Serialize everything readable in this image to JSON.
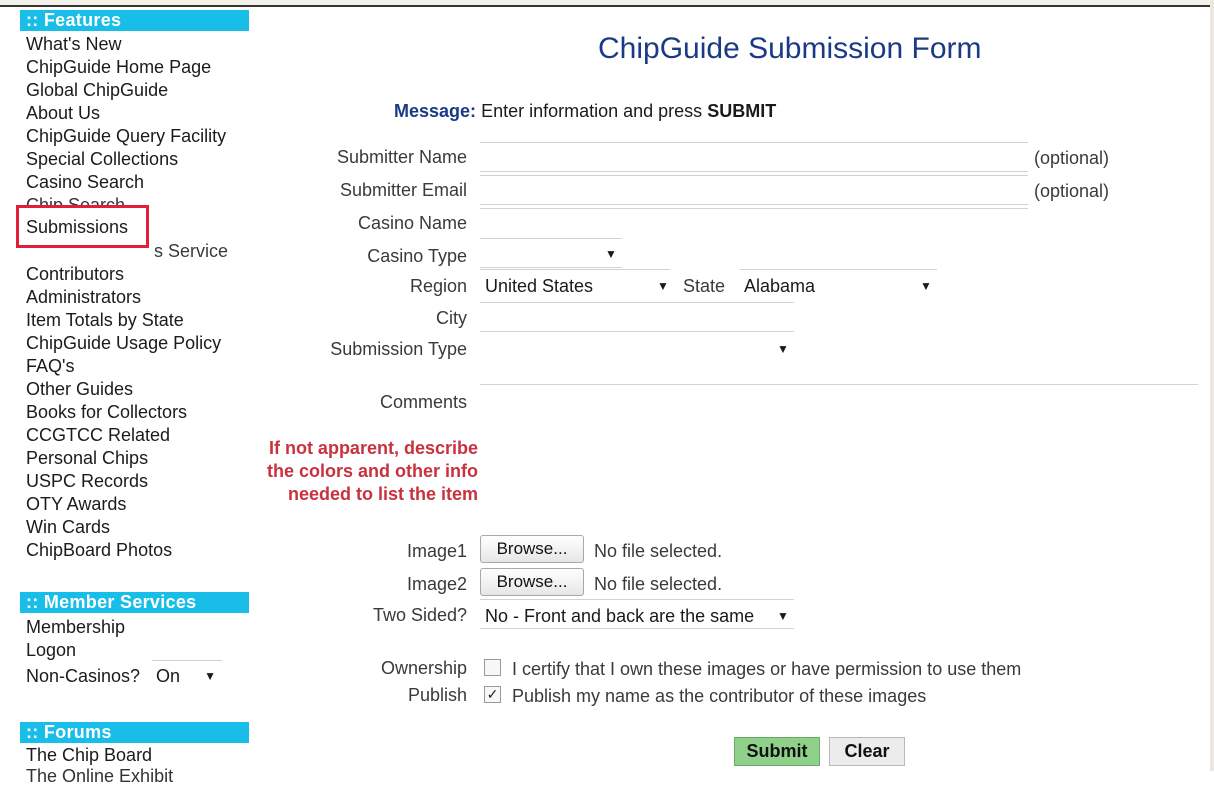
{
  "sidebar": {
    "features_header": ":: Features",
    "features_links": [
      "What's New",
      "ChipGuide Home Page",
      "Global ChipGuide",
      "About Us",
      "ChipGuide Query Facility",
      "Special Collections",
      "Casino Search",
      "Chip Search",
      "Submissions",
      "s Service",
      "Contributors",
      "Administrators",
      "Item Totals by State",
      "ChipGuide Usage Policy",
      "FAQ's",
      "Other Guides",
      "Books for Collectors",
      "CCGTCC Related",
      "Personal Chips",
      "USPC Records",
      "OTY Awards",
      "Win Cards",
      "ChipBoard Photos"
    ],
    "member_header": ":: Member Services",
    "member_links": [
      "Membership",
      "Logon"
    ],
    "non_casinos_label": "Non-Casinos?",
    "non_casinos_value": "On",
    "forums_header": ":: Forums",
    "forums_links": [
      "The Chip Board",
      "The Online Exhibit"
    ]
  },
  "form": {
    "title": "ChipGuide Submission Form",
    "message_key": "Message:",
    "message_text": "Enter information and press",
    "message_bold": "SUBMIT",
    "labels": {
      "submitter_name": "Submitter Name",
      "submitter_email": "Submitter Email",
      "casino_name": "Casino Name",
      "casino_type": "Casino Type",
      "region": "Region",
      "state": "State",
      "city": "City",
      "submission_type": "Submission Type",
      "comments": "Comments",
      "image1": "Image1",
      "image2": "Image2",
      "two_sided": "Two Sided?",
      "ownership": "Ownership",
      "publish": "Publish"
    },
    "optional": "(optional)",
    "region_value": "United States",
    "state_value": "Alabama",
    "two_sided_value": "No - Front and back are the same",
    "comments_note": [
      "If not apparent, describe",
      "the colors and other info",
      "needed to list the item"
    ],
    "browse_label": "Browse...",
    "no_file": "No file selected.",
    "ownership_text": "I certify that I own these images or have permission to use them",
    "ownership_checked": false,
    "publish_text": "Publish my name as the contributor of these images",
    "publish_checked": true,
    "submit_label": "Submit",
    "clear_label": "Clear",
    "colors": {
      "sidebar_header": "#18bde8",
      "title": "#1a3a86",
      "note_red": "#c8323f",
      "highlight_red": "#e0203a",
      "submit_green": "#8fd18a"
    }
  }
}
